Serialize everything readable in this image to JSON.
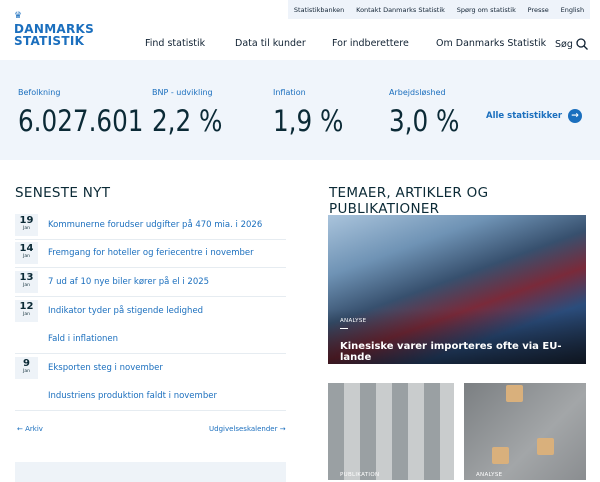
{
  "topbar": [
    "Statistikbanken",
    "Kontakt Danmarks Statistik",
    "Spørg om statistik",
    "Presse",
    "English"
  ],
  "logo": {
    "line1": "DANMARKS",
    "line2": "STATISTIK"
  },
  "nav": [
    "Find statistik",
    "Data til kunder",
    "For indberettere",
    "Om Danmarks Statistik"
  ],
  "search_label": "Søg",
  "stats": [
    {
      "label": "Befolkning",
      "value": "6.027.601"
    },
    {
      "label": "BNP - udvikling",
      "value": "2,2 %"
    },
    {
      "label": "Inflation",
      "value": "1,9 %"
    },
    {
      "label": "Arbejdsløshed",
      "value": "3,0 %"
    }
  ],
  "all_stats": "Alle statistikker",
  "news": {
    "title": "SENESTE NYT",
    "items": [
      {
        "day": "19",
        "month": "Jan",
        "title": "Kommunerne forudser udgifter på 470 mia. i 2026"
      },
      {
        "day": "14",
        "month": "Jan",
        "title": "Fremgang for hoteller og feriecentre i november"
      },
      {
        "day": "13",
        "month": "Jan",
        "title": "7 ud af 10 nye biler kører på el i 2025"
      },
      {
        "day": "12",
        "month": "Jan",
        "title": "Indikator tyder på stigende ledighed"
      },
      {
        "day": "",
        "month": "",
        "title": "Fald i inflationen"
      },
      {
        "day": "9",
        "month": "Jan",
        "title": "Eksporten steg i november"
      },
      {
        "day": "",
        "month": "",
        "title": "Industriens produktion faldt i november"
      }
    ],
    "archive": "Arkiv",
    "calendar": "Udgivelseskalender"
  },
  "themes": {
    "title": "TEMAER, ARTIKLER OG PUBLIKATIONER",
    "featured": {
      "tag": "ANALYSE",
      "title": "Kinesiske varer importeres ofte via EU-lande"
    },
    "cards": [
      {
        "tag": "PUBLIKATION"
      },
      {
        "tag": "ANALYSE"
      }
    ]
  }
}
